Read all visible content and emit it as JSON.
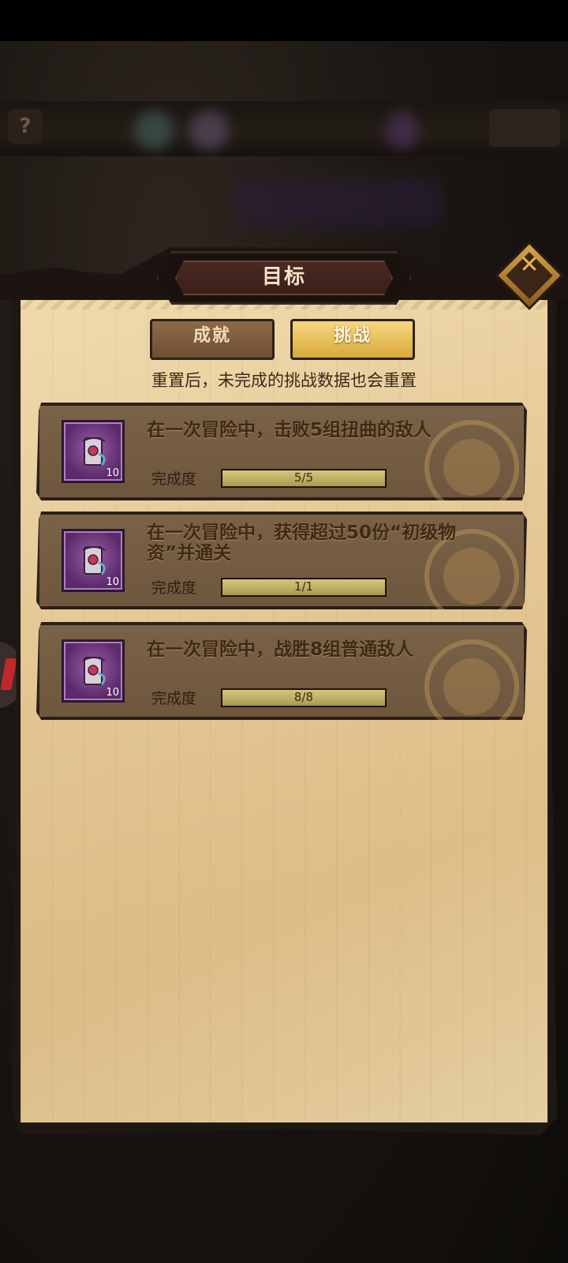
{
  "header": {
    "title": "目标"
  },
  "background": {
    "help_glyph": "?"
  },
  "tabs": [
    {
      "label": "成就",
      "active": false
    },
    {
      "label": "挑战",
      "active": true
    }
  ],
  "reset_note": "重置后，未完成的挑战数据也会重置",
  "challenges": [
    {
      "title": "在一次冒险中，击败5组扭曲的敌人",
      "reward_count": "10",
      "progress_label": "完成度",
      "progress_text": "5/5",
      "progress_fraction": 1.0
    },
    {
      "title": "在一次冒险中，获得超过50份“初级物资”并通关",
      "reward_count": "10",
      "progress_label": "完成度",
      "progress_text": "1/1",
      "progress_fraction": 1.0
    },
    {
      "title": "在一次冒险中，战胜8组普通敌人",
      "reward_count": "10",
      "progress_label": "完成度",
      "progress_text": "8/8",
      "progress_fraction": 1.0
    }
  ],
  "icons": {
    "close": "close-icon",
    "reward": "scroll-item-icon",
    "seal": "emblem-seal-icon"
  },
  "colors": {
    "panel": "#e6c892",
    "card": "#74593f",
    "tab_active": "#e4b648",
    "tab_inactive": "#7a5a3c",
    "progress_fill": "#c9bb6f",
    "item_border": "#5a2a6a"
  }
}
